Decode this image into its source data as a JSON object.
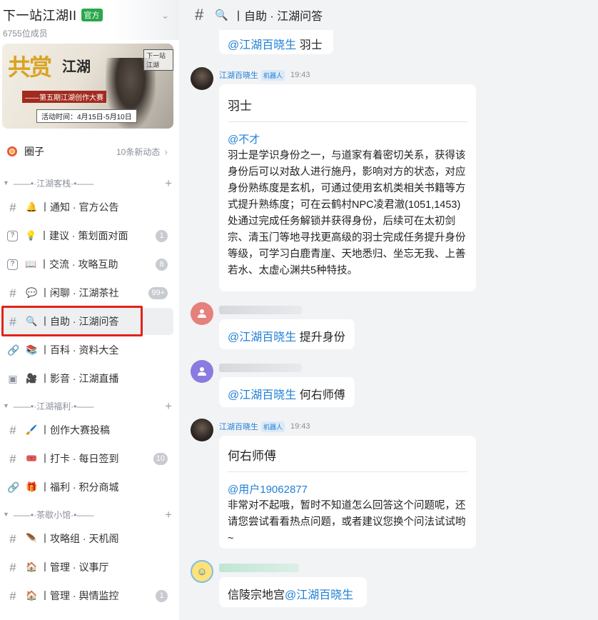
{
  "guild": {
    "name": "下一站江湖II",
    "badge": "官方",
    "members": "6755位成员",
    "chevron_icon": "chevron-down-icon"
  },
  "banner": {
    "title_left": "共赏",
    "title_right": "江湖",
    "subtitle": "——第五期江湖创作大赛",
    "dates": "活动时间：4月15日-5月10日",
    "logo": "下一站江湖"
  },
  "circle": {
    "label": "圈子",
    "count": "10条新动态"
  },
  "categories": [
    {
      "label": "——•·江湖客栈·•——"
    },
    {
      "label": "——•·江湖福利·•——"
    },
    {
      "label": "——•·茶歇小馆·•——"
    }
  ],
  "channels": [
    {
      "type": "text",
      "emoji": "🔔",
      "name": "丨通知 · 官方公告",
      "badge": ""
    },
    {
      "type": "question",
      "emoji": "💡",
      "name": "丨建议 · 策划面对面",
      "badge": "1"
    },
    {
      "type": "question",
      "emoji": "📖",
      "name": "丨交流 · 攻略互助",
      "badge": "8"
    },
    {
      "type": "text",
      "emoji": "💬",
      "name": "丨闲聊 · 江湖茶社",
      "badge": "99+"
    },
    {
      "type": "text",
      "emoji": "🔍",
      "name": "丨自助 · 江湖问答",
      "badge": "",
      "active": true
    },
    {
      "type": "link",
      "emoji": "📚",
      "name": "丨百科 · 资料大全",
      "badge": ""
    },
    {
      "type": "live",
      "emoji": "🎥",
      "name": "丨影音 · 江湖直播",
      "badge": ""
    },
    {
      "type": "text",
      "emoji": "🖌️",
      "name": "丨创作大赛投稿",
      "badge": ""
    },
    {
      "type": "text",
      "emoji": "🎟️",
      "name": "丨打卡 · 每日签到",
      "badge": "10"
    },
    {
      "type": "link",
      "emoji": "🎁",
      "name": "丨福利 · 积分商城",
      "badge": ""
    },
    {
      "type": "locked",
      "emoji": "🪶",
      "name": "丨攻略组 · 天机阁",
      "badge": ""
    },
    {
      "type": "locked",
      "emoji": "🏠",
      "name": "丨管理 · 议事厅",
      "badge": ""
    },
    {
      "type": "locked",
      "emoji": "🏠",
      "name": "丨管理 · 舆情监控",
      "badge": "1"
    }
  ],
  "topbar": {
    "emoji": "🔍",
    "title": "丨自助 · 江湖问答"
  },
  "messages": {
    "m0": {
      "mention": "@江湖百晓生",
      "text": " 羽士"
    },
    "m1": {
      "sender": "江湖百晓生",
      "tag": "机器人",
      "time": "19:43",
      "title": "羽士",
      "mention": "@不才",
      "body": "羽士是学识身份之一，与道家有着密切关系，获得该身份后可以对敌人进行施丹，影响对方的状态，对应身份熟练度是玄机，可通过使用玄机类相关书籍等方式提升熟练度；可在云鹤村NPC凌君澈(1051,1453)处通过完成任务解锁并获得身份，后续可在太初剑宗、清玉门等地寻找更高级的羽士完成任务提升身份等级，可学习白鹿青崖、天地悉归、坐忘无我、上善若水、太虚心渊共5种特技。"
    },
    "m2": {
      "mention": "@江湖百晓生",
      "text": " 提升身份"
    },
    "m3": {
      "mention": "@江湖百晓生",
      "text": " 何右师傅"
    },
    "m4": {
      "sender": "江湖百晓生",
      "tag": "机器人",
      "time": "19:43",
      "title": "何右师傅",
      "mention": "@用户19062877",
      "body": "非常对不起哦，暂时不知道怎么回答这个问题呢，还请您尝试看看热点问题，或者建议您换个问法试试哟~"
    },
    "m5": {
      "text": "信陵宗地宫",
      "mention": "@江湖百晓生"
    }
  }
}
